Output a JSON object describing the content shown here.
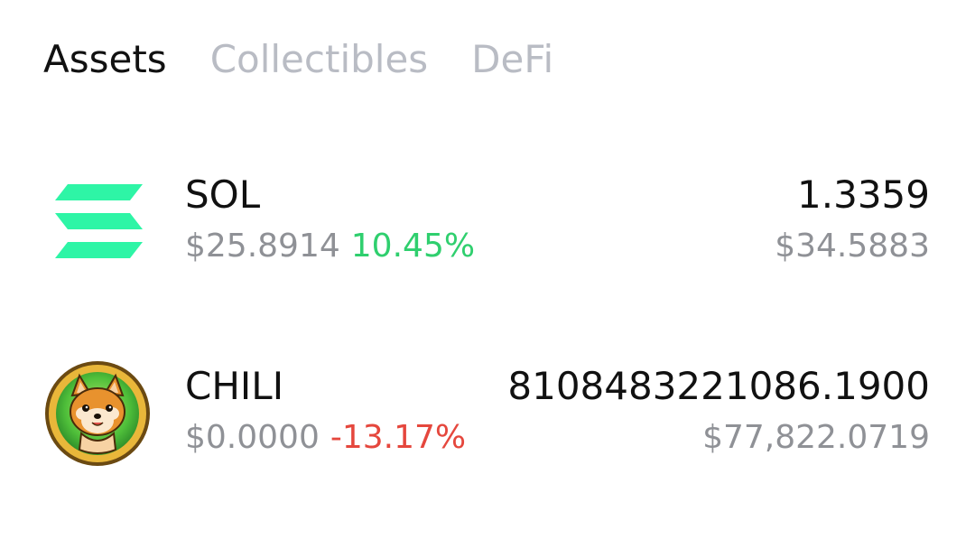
{
  "tabs": [
    {
      "label": "Assets",
      "active": true
    },
    {
      "label": "Collectibles",
      "active": false
    },
    {
      "label": "DeFi",
      "active": false
    }
  ],
  "colors": {
    "active_tab": "#111111",
    "inactive_tab": "#b9bcc4",
    "secondary_text": "#8f9196",
    "positive": "#2fcf6e",
    "negative": "#e5473d",
    "sol_brand": "#2ef5a6"
  },
  "assets": [
    {
      "symbol": "SOL",
      "icon": "solana-logo-icon",
      "price": "$25.8914",
      "change": "10.45%",
      "change_direction": "up",
      "balance": "1.3359",
      "value": "$34.5883"
    },
    {
      "symbol": "CHILI",
      "icon": "shiba-dog-token-icon",
      "price": "$0.0000",
      "change": "-13.17%",
      "change_direction": "down",
      "balance": "8108483221086.1900",
      "value": "$77,822.0719"
    }
  ]
}
